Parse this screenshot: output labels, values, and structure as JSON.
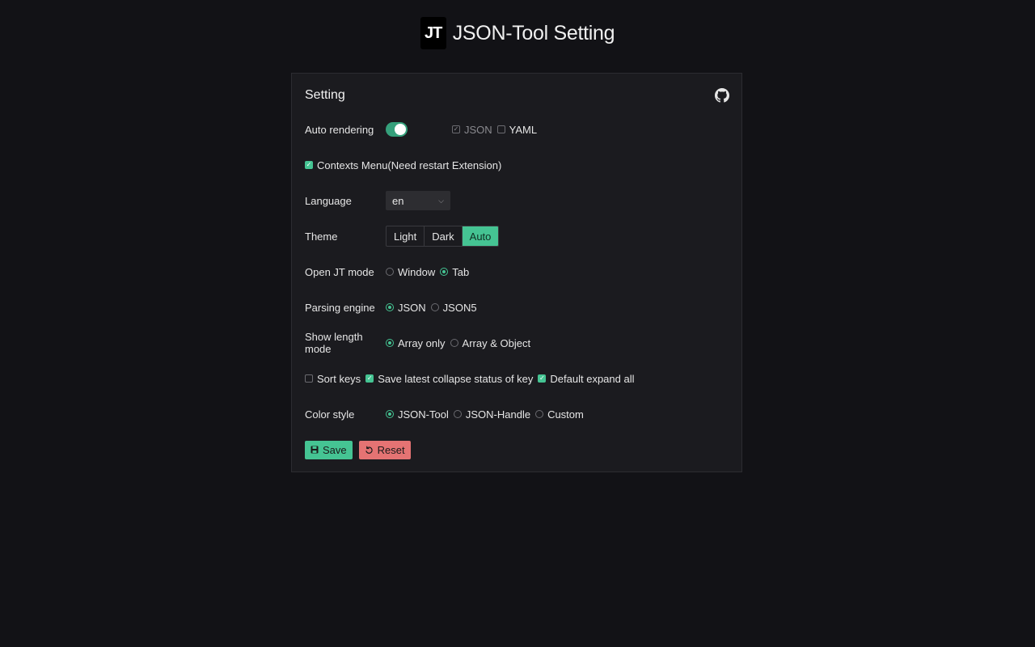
{
  "header": {
    "logo_text": "JT",
    "title": "JSON-Tool Setting"
  },
  "card": {
    "title": "Setting",
    "github_icon": "github-icon"
  },
  "auto_rendering": {
    "label": "Auto rendering",
    "enabled": true,
    "json_label": "JSON",
    "json_checked": true,
    "json_disabled": true,
    "yaml_label": "YAML",
    "yaml_checked": false
  },
  "contexts_menu": {
    "label": "Contexts Menu(Need restart Extension)",
    "checked": true
  },
  "language": {
    "label": "Language",
    "value": "en"
  },
  "theme": {
    "label": "Theme",
    "options": [
      "Light",
      "Dark",
      "Auto"
    ],
    "selected": "Auto"
  },
  "open_mode": {
    "label": "Open JT mode",
    "options": [
      "Window",
      "Tab"
    ],
    "selected": "Tab"
  },
  "parsing_engine": {
    "label": "Parsing engine",
    "options": [
      "JSON",
      "JSON5"
    ],
    "selected": "JSON"
  },
  "show_length_mode": {
    "label": "Show length mode",
    "options": [
      "Array only",
      "Array & Object"
    ],
    "selected": "Array only"
  },
  "misc": {
    "sort_keys_label": "Sort keys",
    "sort_keys_checked": false,
    "save_collapse_label": "Save latest collapse status of key",
    "save_collapse_checked": true,
    "default_expand_label": "Default expand all",
    "default_expand_checked": true
  },
  "color_style": {
    "label": "Color style",
    "options": [
      "JSON-Tool",
      "JSON-Handle",
      "Custom"
    ],
    "selected": "JSON-Tool"
  },
  "actions": {
    "save_label": "Save",
    "reset_label": "Reset"
  },
  "colors": {
    "accent": "#45c493",
    "danger": "#e57373",
    "background": "#121216",
    "card": "#1b1b1f"
  }
}
